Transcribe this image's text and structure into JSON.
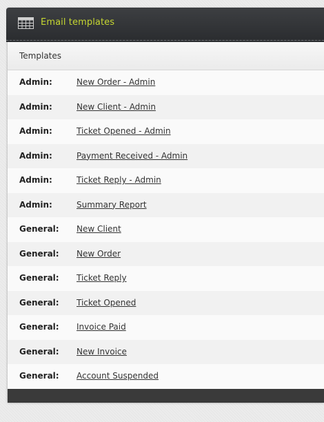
{
  "header": {
    "title": "Email templates",
    "icon": "grid-table-icon",
    "accent_color": "#c5d631"
  },
  "subheader": {
    "title": "Templates"
  },
  "templates": [
    {
      "category": "Admin:",
      "name": "New Order - Admin"
    },
    {
      "category": "Admin:",
      "name": "New Client - Admin"
    },
    {
      "category": "Admin:",
      "name": "Ticket Opened - Admin"
    },
    {
      "category": "Admin:",
      "name": "Payment Received - Admin"
    },
    {
      "category": "Admin:",
      "name": "Ticket Reply - Admin"
    },
    {
      "category": "Admin:",
      "name": "Summary Report"
    },
    {
      "category": "General:",
      "name": "New Client"
    },
    {
      "category": "General:",
      "name": "New Order"
    },
    {
      "category": "General:",
      "name": "Ticket Reply"
    },
    {
      "category": "General:",
      "name": "Ticket Opened"
    },
    {
      "category": "General:",
      "name": "Invoice Paid"
    },
    {
      "category": "General:",
      "name": "New Invoice"
    },
    {
      "category": "General:",
      "name": "Account Suspended"
    }
  ]
}
